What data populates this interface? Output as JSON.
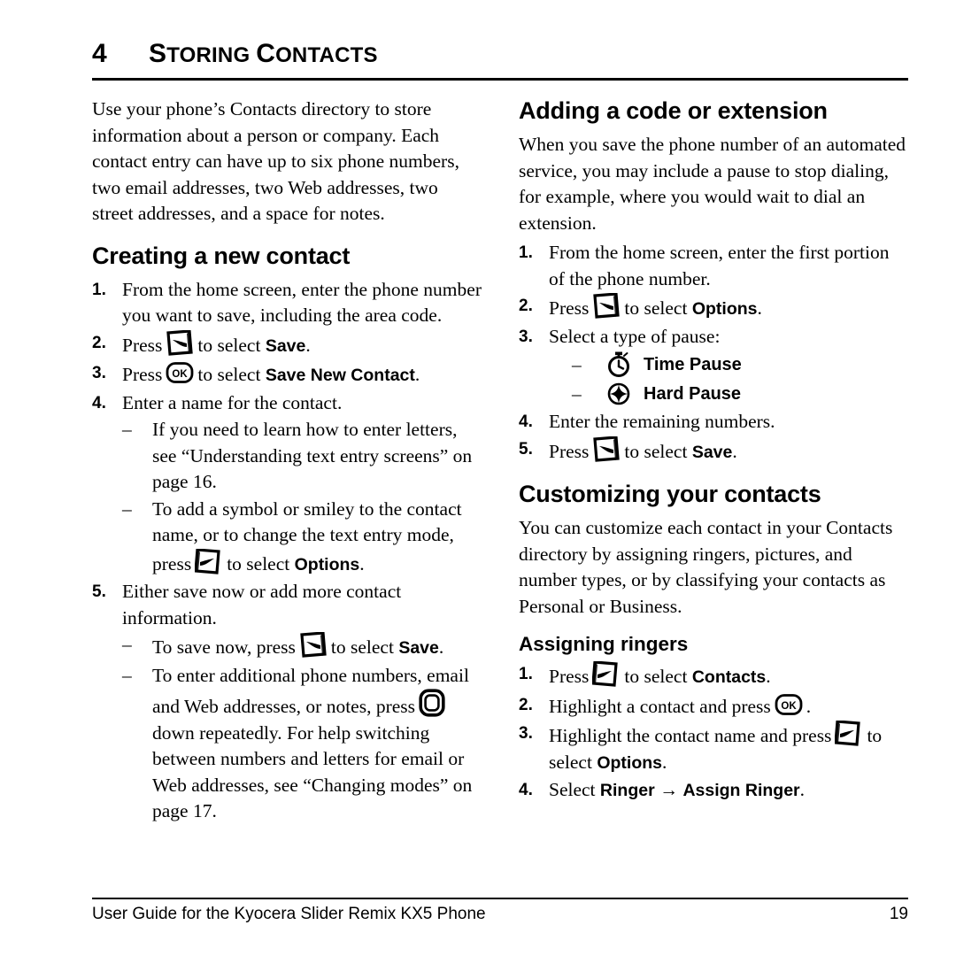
{
  "chapter": {
    "number": "4",
    "title_first": "S",
    "title_rest": "TORING ",
    "title_first2": "C",
    "title_rest2": "ONTACTS"
  },
  "left_column": {
    "intro": "Use your phone’s Contacts directory to store information about a person or company. Each contact entry can have up to six phone numbers, two email addresses, two Web addresses, two street addresses, and a space for notes.",
    "section_heading": "Creating a new contact",
    "steps": [
      {
        "marker": "1.",
        "text": "From the home screen, enter the phone number you want to save, including the area code."
      },
      {
        "marker": "2.",
        "pre": "Press",
        "icon": "left-softkey-icon",
        "mid": "to select",
        "bold": "Save",
        "post": "."
      },
      {
        "marker": "3.",
        "pre": "Press",
        "icon": "ok-key-icon",
        "mid": "to select",
        "bold": "Save New Contact",
        "post": "."
      },
      {
        "marker": "4.",
        "text": "Enter a name for the contact."
      }
    ],
    "substeps_4": [
      {
        "marker": "–",
        "text": "If you need to learn how to enter letters, see “Understanding text entry screens” on page 16."
      },
      {
        "marker": "–",
        "pre": "To add a symbol or smiley to the contact name, or to change the text entry mode, press",
        "icon": "right-softkey-icon",
        "mid": "to select",
        "bold": "Options",
        "post": "."
      }
    ],
    "step_5": {
      "marker": "5.",
      "text": "Either save now or add more contact information."
    },
    "substeps_5": [
      {
        "marker": "–",
        "pre": "To save now, press",
        "icon": "left-softkey-icon",
        "mid": "to select",
        "bold": "Save",
        "post": "."
      },
      {
        "marker": "–",
        "pre": "To enter additional phone numbers, email and Web addresses, or notes, press",
        "icon": "nav-key-icon",
        "post": "down repeatedly. For help switching between numbers and letters for email or Web addresses, see “Changing modes” on page 17."
      }
    ]
  },
  "right_column": {
    "section_heading_1": "Adding a code or extension",
    "intro_1": "When you save the phone number of an automated service, you may include a pause to stop dialing, for example, where you would wait to dial an extension.",
    "steps_1": [
      {
        "marker": "1.",
        "text": "From the home screen, enter the first portion of the phone number."
      },
      {
        "marker": "2.",
        "pre": "Press",
        "icon": "left-softkey-icon",
        "mid": "to select",
        "bold": "Options",
        "post": "."
      },
      {
        "marker": "3.",
        "text": "Select a type of pause:"
      }
    ],
    "pause_options": [
      {
        "marker": "–",
        "icon": "stopwatch-icon",
        "label": "Time Pause"
      },
      {
        "marker": "–",
        "icon": "hard-pause-icon",
        "label": "Hard Pause"
      }
    ],
    "steps_1_cont": [
      {
        "marker": "4.",
        "text": "Enter the remaining numbers."
      },
      {
        "marker": "5.",
        "pre": "Press",
        "icon": "left-softkey-icon",
        "mid": "to select",
        "bold": "Save",
        "post": "."
      }
    ],
    "section_heading_2": "Customizing your contacts",
    "intro_2": "You can customize each contact in your Contacts directory by assigning ringers, pictures, and number types, or by classifying your contacts as Personal or Business.",
    "sub_heading": "Assigning ringers",
    "steps_2": [
      {
        "marker": "1.",
        "pre": "Press",
        "icon": "right-softkey-icon",
        "mid": "to select",
        "bold": "Contacts",
        "post": "."
      },
      {
        "marker": "2.",
        "pre": "Highlight a contact and press",
        "icon": "ok-key-icon",
        "post": "."
      },
      {
        "marker": "3.",
        "pre": "Highlight the contact name and press",
        "icon": "right-softkey-icon",
        "mid": "to",
        "post": "select",
        "bold": "Options",
        "tail": "."
      },
      {
        "marker": "4.",
        "pre": "Select",
        "bold": "Ringer",
        "arrow": "→",
        "bold2": "Assign Ringer",
        "post": "."
      }
    ]
  },
  "footer": {
    "text": "User Guide for the Kyocera Slider Remix KX5 Phone",
    "page": "19"
  }
}
